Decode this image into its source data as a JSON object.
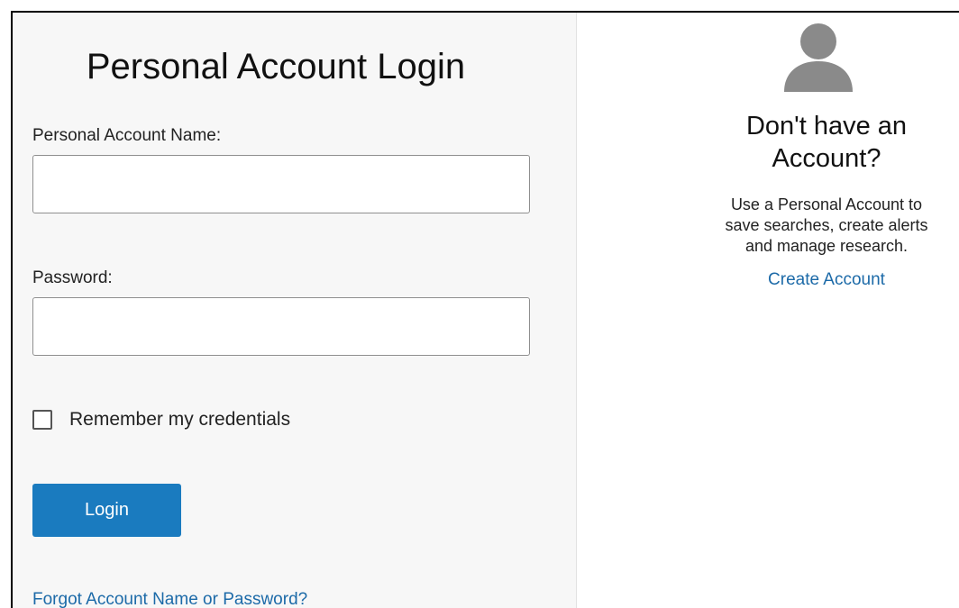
{
  "login": {
    "title": "Personal Account Login",
    "account_name_label": "Personal Account Name:",
    "account_name_value": "",
    "password_label": "Password:",
    "password_value": "",
    "remember_label": "Remember my credentials",
    "remember_checked": false,
    "login_button": "Login",
    "forgot_link": "Forgot Account Name or Password?"
  },
  "signup": {
    "icon": "user-avatar-icon",
    "title_line1": "Don't have an",
    "title_line2": "Account?",
    "description_line1": "Use a Personal Account to",
    "description_line2": "save searches, create alerts",
    "description_line3": "and manage research.",
    "create_link": "Create Account"
  },
  "colors": {
    "accent": "#1a7bbf",
    "link": "#1c6aa8",
    "left_panel_bg": "#f7f7f7",
    "icon_gray": "#8a8a8a"
  }
}
